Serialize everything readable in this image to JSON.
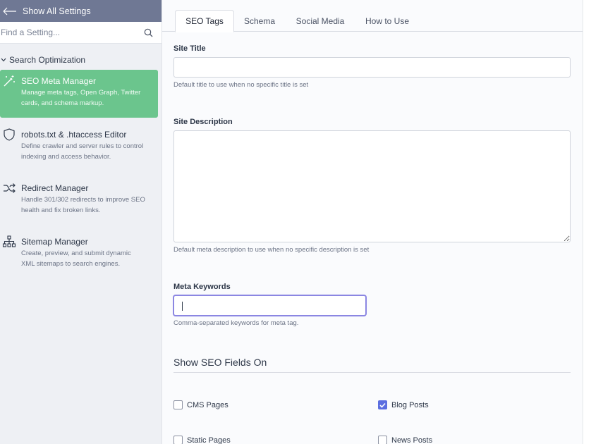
{
  "sidebar": {
    "back_label": "Show All Settings",
    "search_placeholder": "Find a Setting...",
    "section_title": "Search Optimization",
    "items": [
      {
        "title": "SEO Meta Manager",
        "desc1": "Manage meta tags, Open Graph, Twitter",
        "desc2": "cards, and schema markup.",
        "icon": "magic-wand-icon"
      },
      {
        "title": "robots.txt & .htaccess Editor",
        "desc1": "Define crawler and server rules to control",
        "desc2": "indexing and access behavior.",
        "icon": "shield-icon"
      },
      {
        "title": "Redirect Manager",
        "desc1": "Handle 301/302 redirects to improve SEO",
        "desc2": "health and fix broken links.",
        "icon": "shuffle-icon"
      },
      {
        "title": "Sitemap Manager",
        "desc1": "Create, preview, and submit dynamic",
        "desc2": "XML sitemaps to search engines.",
        "icon": "sitemap-icon"
      }
    ]
  },
  "tabs": [
    "SEO Tags",
    "Schema",
    "Social Media",
    "How to Use"
  ],
  "form": {
    "site_title_label": "Site Title",
    "site_title_value": "",
    "site_title_hint": "Default title to use when no specific title is set",
    "site_desc_label": "Site Description",
    "site_desc_value": "",
    "site_desc_hint": "Default meta description to use when no specific description is set",
    "keywords_label": "Meta Keywords",
    "keywords_value": "",
    "keywords_hint": "Comma-separated keywords for meta tag."
  },
  "show_on": {
    "title": "Show SEO Fields On",
    "options": [
      {
        "label": "CMS Pages",
        "checked": false
      },
      {
        "label": "Blog Posts",
        "checked": true
      },
      {
        "label": "Static Pages",
        "checked": false
      },
      {
        "label": "News Posts",
        "checked": false
      }
    ]
  },
  "colors": {
    "accent_green": "#6bc58d",
    "topbar": "#6f7894",
    "checkbox_on": "#5b6ee0",
    "focus": "#8b86e2"
  }
}
